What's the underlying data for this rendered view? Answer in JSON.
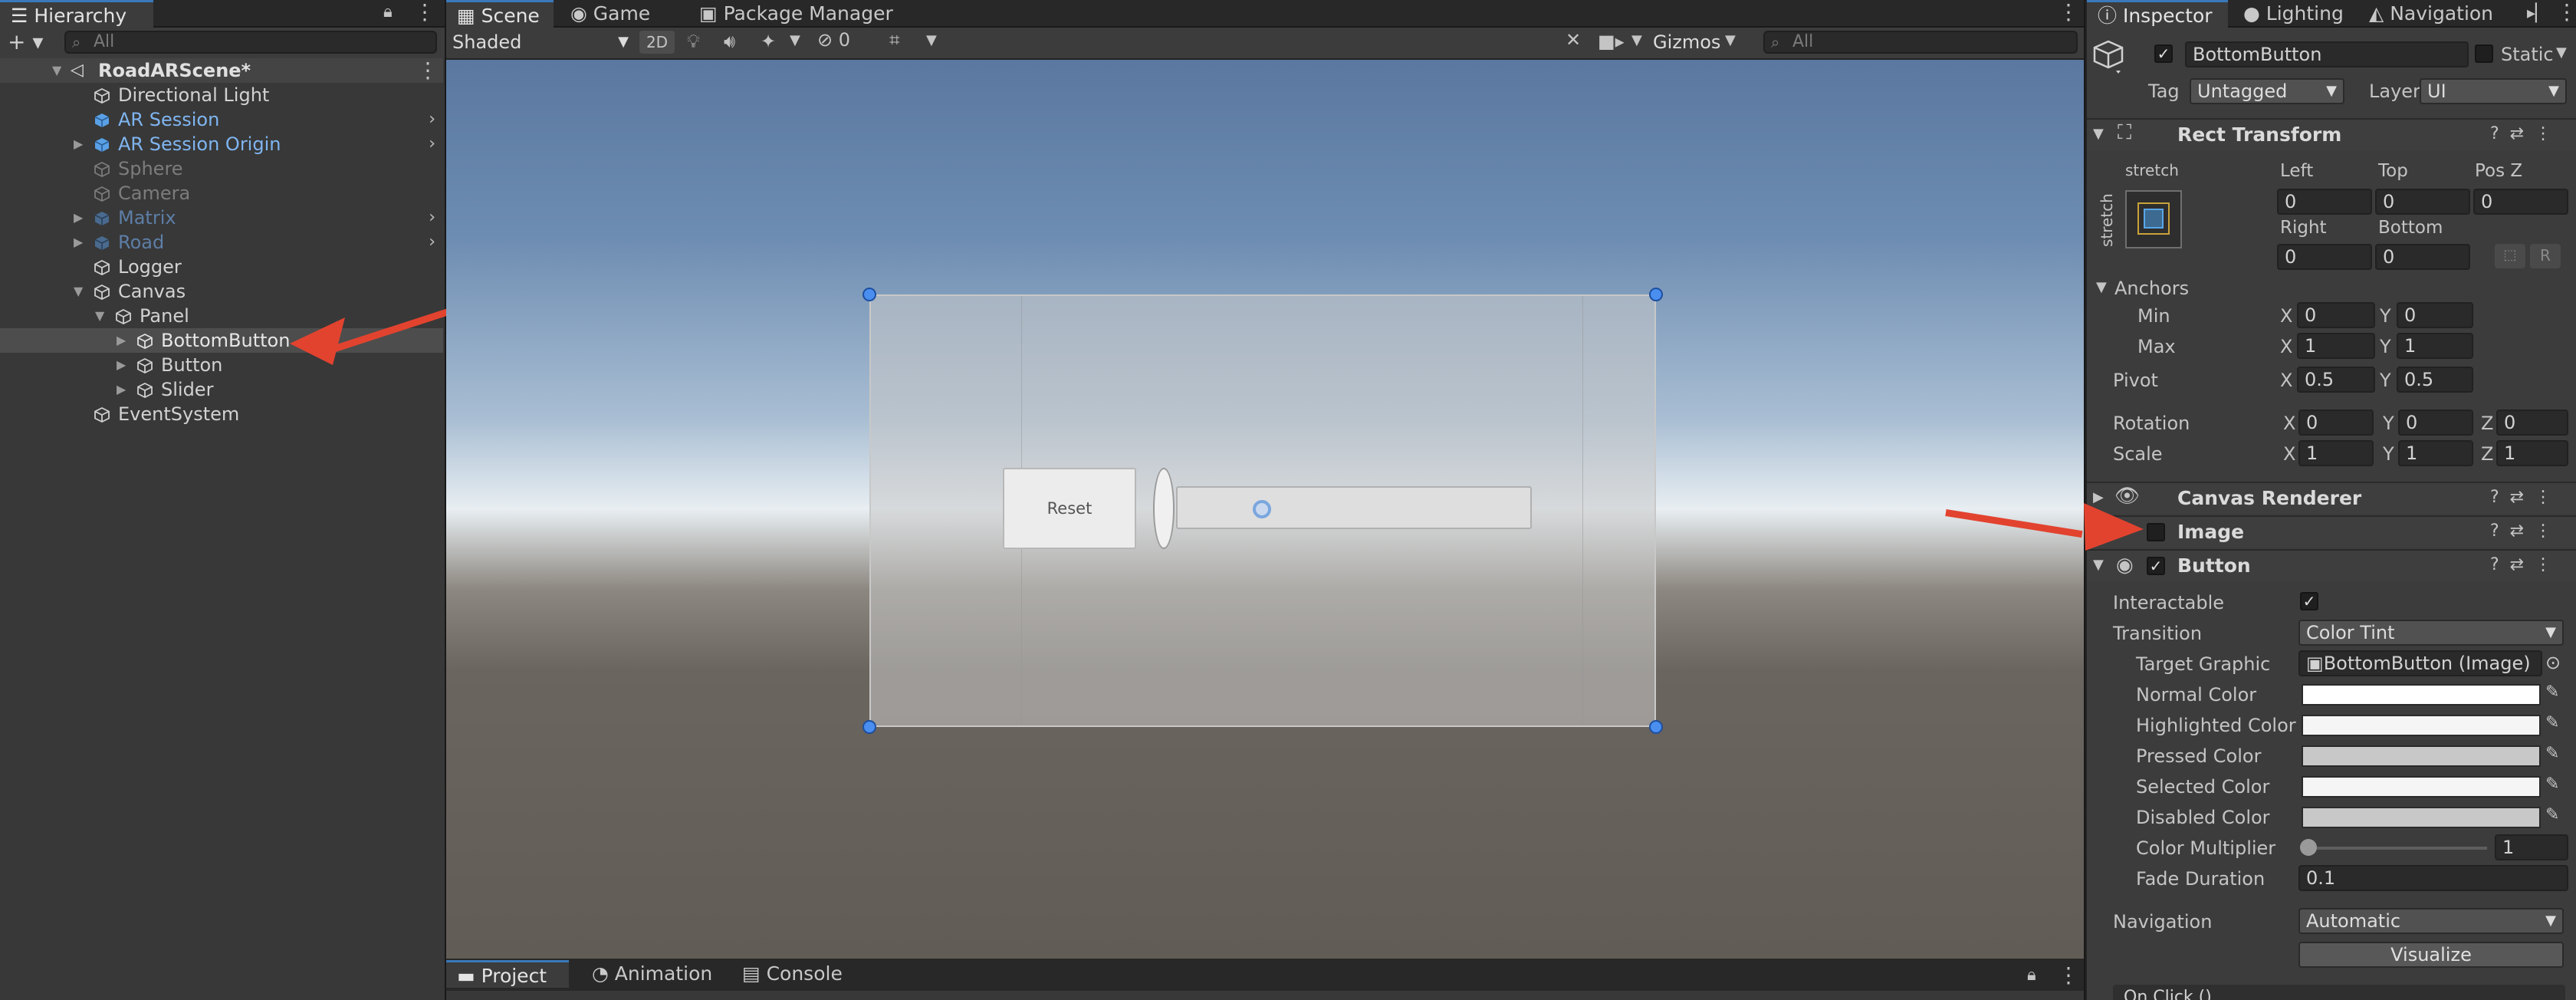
{
  "hierarchy": {
    "tab": "Hierarchy",
    "search_placeholder": "All",
    "add_symbol": "+ ▾",
    "scene": "RoadARScene*",
    "items": [
      {
        "label": "Directional Light",
        "style": "normal"
      },
      {
        "label": "AR Session",
        "style": "prefab"
      },
      {
        "label": "AR Session Origin",
        "style": "prefab"
      },
      {
        "label": "Sphere",
        "style": "disabled"
      },
      {
        "label": "Camera",
        "style": "disabled"
      },
      {
        "label": "Matrix",
        "style": "prefab-disabled"
      },
      {
        "label": "Road",
        "style": "prefab-disabled"
      },
      {
        "label": "Logger",
        "style": "normal"
      },
      {
        "label": "Canvas",
        "style": "normal"
      },
      {
        "label": "Panel",
        "style": "normal"
      },
      {
        "label": "BottomButton",
        "style": "selected"
      },
      {
        "label": "Button",
        "style": "normal"
      },
      {
        "label": "Slider",
        "style": "normal"
      },
      {
        "label": "EventSystem",
        "style": "normal"
      }
    ]
  },
  "scene_view": {
    "tabs": [
      "Scene",
      "Game",
      "Package Manager"
    ],
    "shading_mode": "Shaded",
    "mode_2d": "2D",
    "hidden_count": "0",
    "gizmos": "Gizmos",
    "search_placeholder": "All",
    "reset_button": "Reset"
  },
  "bottom_panel": {
    "tabs": [
      "Project",
      "Animation",
      "Console"
    ]
  },
  "inspector": {
    "tabs": [
      "Inspector",
      "Lighting",
      "Navigation"
    ],
    "object_name": "BottomButton",
    "static_label": "Static",
    "tag_label": "Tag",
    "tag_value": "Untagged",
    "layer_label": "Layer",
    "layer_value": "UI",
    "rect_transform": {
      "title": "Rect Transform",
      "anchor_h": "stretch",
      "anchor_v": "stretch",
      "left_label": "Left",
      "left": "0",
      "top_label": "Top",
      "top": "0",
      "posz_label": "Pos Z",
      "posz": "0",
      "right_label": "Right",
      "right": "0",
      "bottom_label": "Bottom",
      "bottom": "0",
      "r_button": "R",
      "anchors_label": "Anchors",
      "min_label": "Min",
      "min_x": "0",
      "min_y": "0",
      "max_label": "Max",
      "max_x": "1",
      "max_y": "1",
      "pivot_label": "Pivot",
      "pivot_x": "0.5",
      "pivot_y": "0.5",
      "rotation_label": "Rotation",
      "rot_x": "0",
      "rot_y": "0",
      "rot_z": "0",
      "scale_label": "Scale",
      "scale_x": "1",
      "scale_y": "1",
      "scale_z": "1",
      "x": "X",
      "y": "Y",
      "z": "Z"
    },
    "canvas_renderer": "Canvas Renderer",
    "image": "Image",
    "button": {
      "title": "Button",
      "interactable_label": "Interactable",
      "transition_label": "Transition",
      "transition": "Color Tint",
      "target_graphic_label": "Target Graphic",
      "target_graphic": "BottomButton (Image)",
      "normal_color_label": "Normal Color",
      "highlighted_color_label": "Highlighted Color",
      "pressed_color_label": "Pressed Color",
      "selected_color_label": "Selected Color",
      "disabled_color_label": "Disabled Color",
      "color_multiplier_label": "Color Multiplier",
      "color_multiplier": "1",
      "fade_duration_label": "Fade Duration",
      "fade_duration": "0.1",
      "navigation_label": "Navigation",
      "navigation": "Automatic",
      "visualize": "Visualize",
      "on_click": "On Click ()"
    },
    "colors": {
      "normal": "#ffffff",
      "highlighted": "#f5f5f5",
      "pressed": "#c8c8c8",
      "selected": "#f5f5f5",
      "disabled": "#c8c8c8"
    }
  }
}
